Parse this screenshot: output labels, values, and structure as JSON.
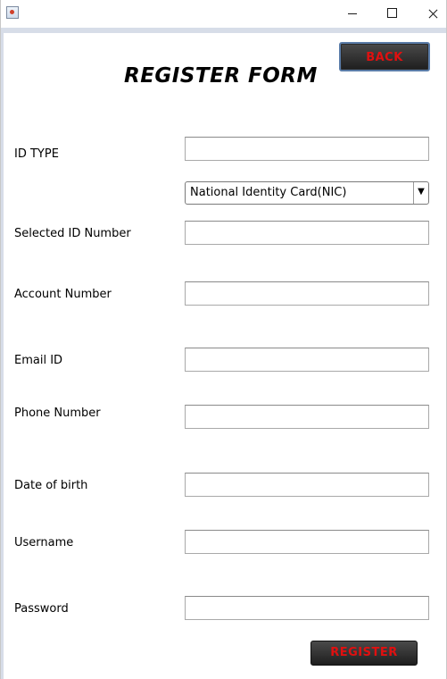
{
  "window": {
    "controls": {
      "minimize": "minimize",
      "maximize": "maximize",
      "close": "close"
    }
  },
  "header": {
    "title": "REGISTER FORM",
    "back_label": "BACK"
  },
  "form": {
    "id_type_label": "ID TYPE",
    "id_type_value": "",
    "id_type_select_value": "National Identity Card(NIC)",
    "selected_id_number_label": "Selected ID Number",
    "account_number_label": "Account Number",
    "email_label": "Email ID",
    "phone_label": "Phone Number",
    "dob_label": "Date of birth",
    "username_label": "Username",
    "password_label": "Password",
    "register_label": "REGISTER"
  },
  "colors": {
    "button_text": "#e01010",
    "button_bg": "#2a2a2a",
    "frame": "#d7dde8"
  },
  "icons": {
    "dropdown": "chevron-down-icon",
    "app": "java-app-icon"
  }
}
